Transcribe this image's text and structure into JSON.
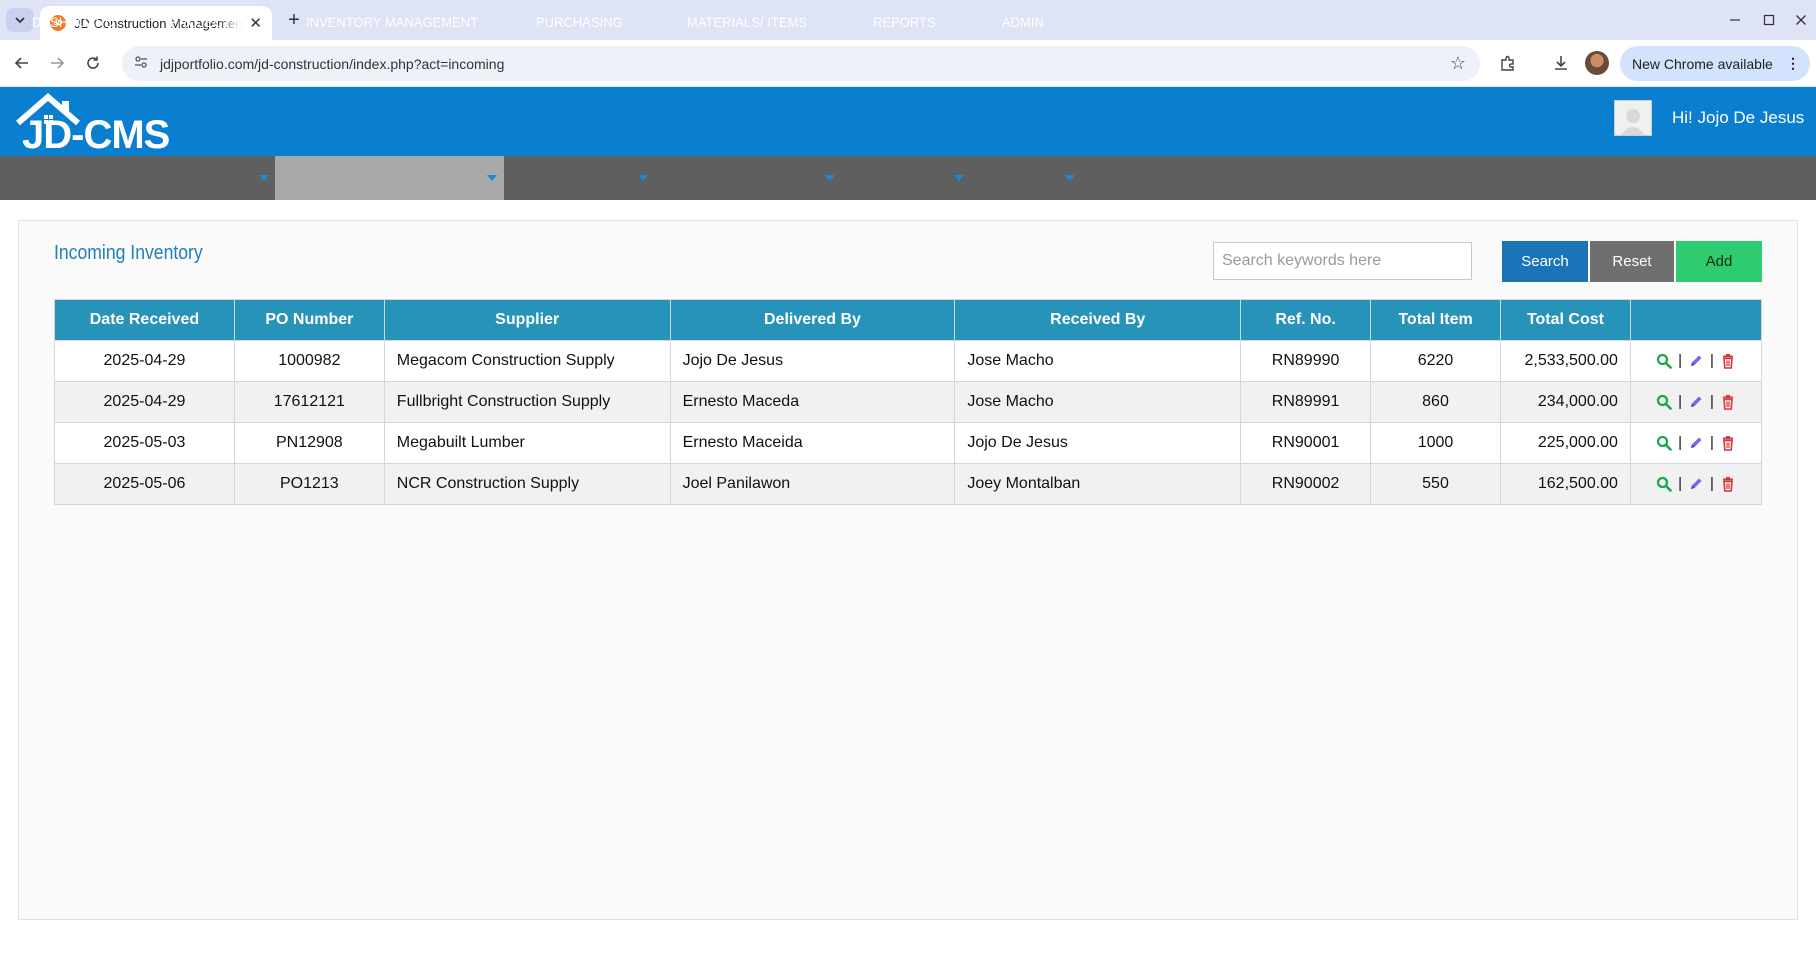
{
  "browser": {
    "tab_title": "JD Construction Management",
    "favicon_text": "JD",
    "url": "jdjportfolio.com/jd-construction/index.php?act=incoming",
    "update_label": "New Chrome available"
  },
  "header": {
    "logo_text": "JD-CMS",
    "greeting": "Hi! Jojo De Jesus"
  },
  "menu": {
    "items": [
      {
        "label": "DASHBOARD"
      },
      {
        "label": "PROJECTS"
      },
      {
        "label": "INVENTORY MANAGEMENT"
      },
      {
        "label": "PURCHASING"
      },
      {
        "label": "MATERIALS/ ITEMS"
      },
      {
        "label": "REPORTS"
      },
      {
        "label": "ADMIN"
      }
    ],
    "active": "INVENTORY MANAGEMENT"
  },
  "page": {
    "title": "Incoming Inventory",
    "search_placeholder": "Search keywords here",
    "search_label": "Search",
    "reset_label": "Reset",
    "add_label": "Add"
  },
  "table": {
    "columns": [
      "Date Received",
      "PO Number",
      "Supplier",
      "Delivered By",
      "Received By",
      "Ref. No.",
      "Total Item",
      "Total Cost",
      ""
    ],
    "rows": [
      {
        "date": "2025-04-29",
        "po": "1000982",
        "supplier": "Megacom Construction Supply",
        "delivered_by": "Jojo De Jesus",
        "received_by": "Jose Macho",
        "ref": "RN89990",
        "total_item": "6220",
        "total_cost": "2,533,500.00"
      },
      {
        "date": "2025-04-29",
        "po": "17612121",
        "supplier": "Fullbright Construction Supply",
        "delivered_by": "Ernesto Maceda",
        "received_by": "Jose Macho",
        "ref": "RN89991",
        "total_item": "860",
        "total_cost": "234,000.00"
      },
      {
        "date": "2025-05-03",
        "po": "PN12908",
        "supplier": "Megabuilt Lumber",
        "delivered_by": "Ernesto Maceida",
        "received_by": "Jojo De Jesus",
        "ref": "RN90001",
        "total_item": "1000",
        "total_cost": "225,000.00"
      },
      {
        "date": "2025-05-06",
        "po": "PO1213",
        "supplier": "NCR Construction Supply",
        "delivered_by": "Joel Panilawon",
        "received_by": "Joey Montalban",
        "ref": "RN90002",
        "total_item": "550",
        "total_cost": "162,500.00"
      }
    ],
    "action_separator": "|"
  },
  "colors": {
    "header_blue": "#0a7fcf",
    "menu_gray": "#5f5f5f",
    "table_header": "#2893b8",
    "search_button": "#1b74b8",
    "reset_button": "#6f6f6f",
    "add_button": "#2ecc71",
    "view_icon": "#1aa84a",
    "edit_icon": "#6a6cf0",
    "delete_icon": "#d9363e"
  },
  "icons": {
    "row_actions": [
      "search-icon",
      "pencil-icon",
      "trash-icon"
    ]
  }
}
